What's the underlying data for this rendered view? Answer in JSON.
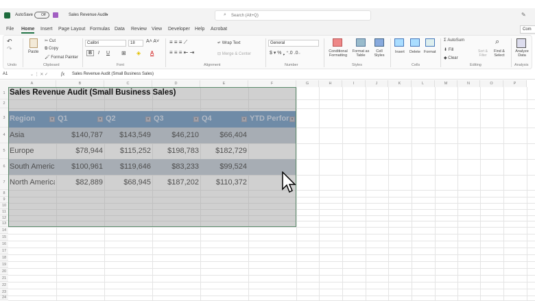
{
  "titlebar": {
    "autosave": "AutoSave",
    "toggle": "Off",
    "doc_title": "Sales Revenue Audit",
    "search": "Search (Alt+Q)"
  },
  "tabs": [
    "File",
    "Home",
    "Insert",
    "Page Layout",
    "Formulas",
    "Data",
    "Review",
    "View",
    "Developer",
    "Help",
    "Acrobat"
  ],
  "comments": "Com",
  "ribbon": {
    "undo": "Undo",
    "paste": "Paste",
    "cut": "Cut",
    "copy": "Copy",
    "format_painter": "Format Painter",
    "clipboard": "Clipboard",
    "font_name": "Calibri",
    "font_size": "18",
    "font": "Font",
    "wrap_text": "Wrap Text",
    "merge": "Merge & Center",
    "alignment": "Alignment",
    "number_format": "General",
    "number": "Number",
    "cond_fmt": "Conditional Formatting",
    "fmt_table": "Format as Table",
    "cell_styles": "Cell Styles",
    "styles": "Styles",
    "insert": "Insert",
    "delete": "Delete",
    "format": "Format",
    "cells": "Cells",
    "autosum": "AutoSum",
    "fill": "Fill",
    "clear": "Clear",
    "sort": "Sort & Filter",
    "find": "Find & Select",
    "editing": "Editing",
    "analyze": "Analyze Data",
    "analysis": "Analysis"
  },
  "formula": {
    "name_box": "A1",
    "fx": "fx",
    "content": "Sales Revenue Audit (Small Business Sales)"
  },
  "columns": [
    "A",
    "B",
    "C",
    "D",
    "E",
    "F",
    "G",
    "H",
    "I",
    "J",
    "K",
    "L",
    "M",
    "N",
    "O",
    "P"
  ],
  "rows": [
    "1",
    "2",
    "3",
    "4",
    "5",
    "6",
    "7",
    "8",
    "9",
    "10",
    "11",
    "12",
    "13",
    "14",
    "15",
    "16",
    "17",
    "18",
    "19",
    "20",
    "21",
    "22",
    "23",
    "24"
  ],
  "sheet": {
    "title": "Sales Revenue Audit (Small Business Sales)",
    "headers": [
      "Region",
      "Q1",
      "Q2",
      "Q3",
      "Q4",
      "YTD Perform"
    ],
    "data": [
      [
        "Asia",
        "$140,787",
        "$143,549",
        "$46,210",
        "$66,404"
      ],
      [
        "Europe",
        "$78,944",
        "$115,252",
        "$198,783",
        "$182,729"
      ],
      [
        "South America",
        "$100,961",
        "$119,646",
        "$83,233",
        "$99,524"
      ],
      [
        "North America",
        "$82,889",
        "$68,945",
        "$187,202",
        "$110,372"
      ]
    ],
    "header_color": "#4f81b4",
    "band_color": "#b4bfcc"
  }
}
